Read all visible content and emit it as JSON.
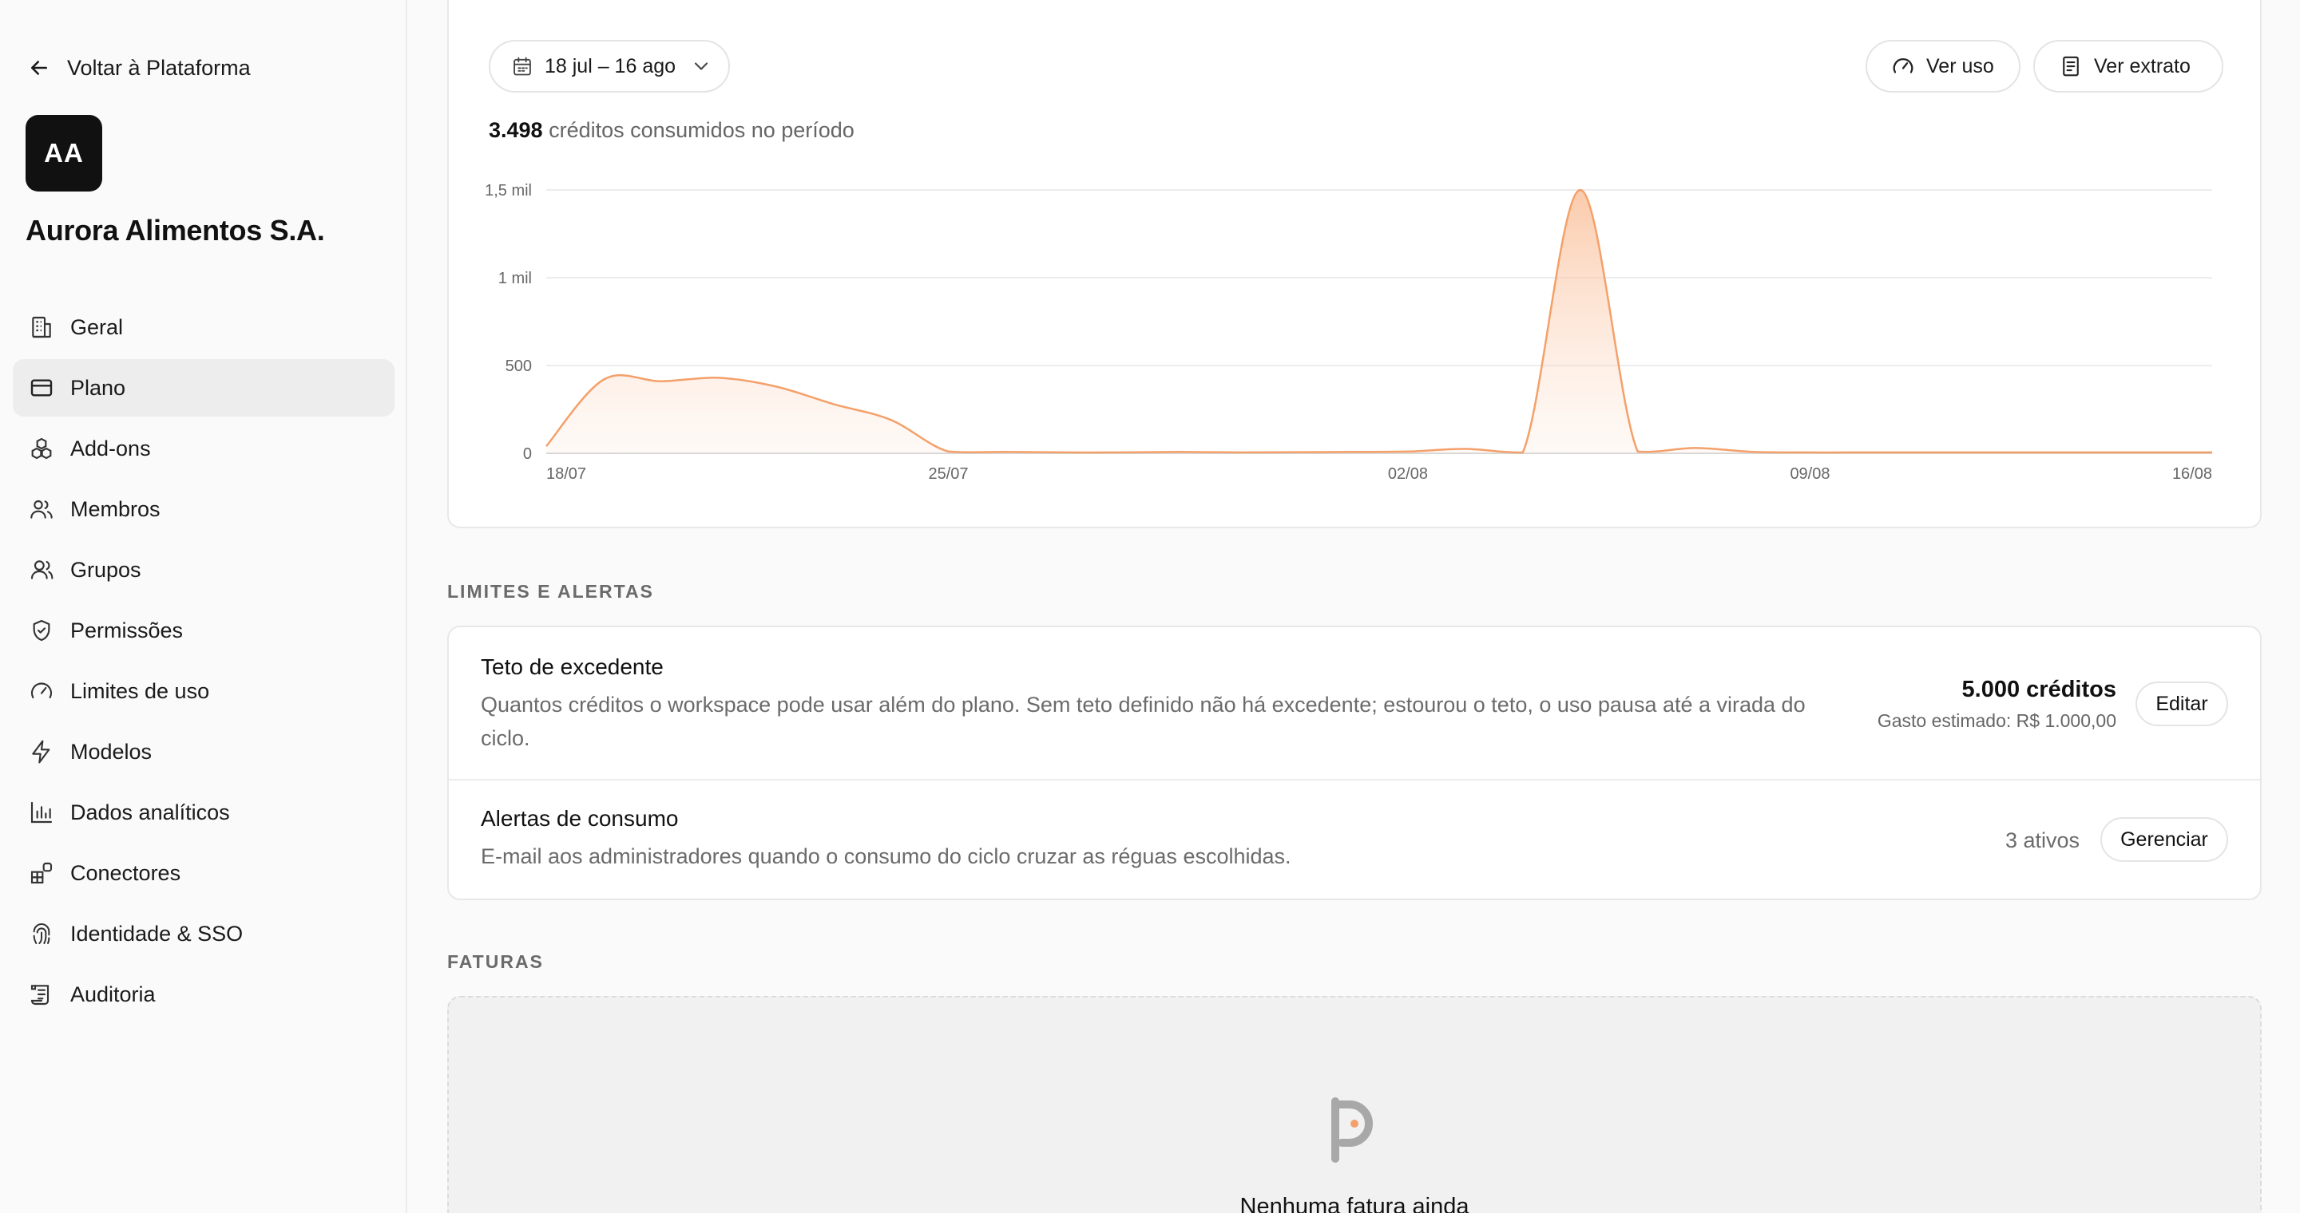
{
  "sidebar": {
    "back_label": "Voltar à Plataforma",
    "org_initials": "AA",
    "org_name": "Aurora Alimentos S.A.",
    "items": [
      {
        "label": "Geral",
        "icon": "building-icon"
      },
      {
        "label": "Plano",
        "icon": "credit-card-icon",
        "active": true
      },
      {
        "label": "Add-ons",
        "icon": "blocks-icon"
      },
      {
        "label": "Membros",
        "icon": "users-icon"
      },
      {
        "label": "Grupos",
        "icon": "group-icon"
      },
      {
        "label": "Permissões",
        "icon": "shield-check-icon"
      },
      {
        "label": "Limites de uso",
        "icon": "gauge-icon"
      },
      {
        "label": "Modelos",
        "icon": "lightning-icon"
      },
      {
        "label": "Dados analíticos",
        "icon": "bar-chart-icon"
      },
      {
        "label": "Conectores",
        "icon": "apps-plus-icon"
      },
      {
        "label": "Identidade & SSO",
        "icon": "fingerprint-icon"
      },
      {
        "label": "Auditoria",
        "icon": "scroll-icon"
      }
    ]
  },
  "usage": {
    "date_range": "18 jul – 16 ago",
    "ver_uso": "Ver uso",
    "ver_extrato": "Ver extrato",
    "credits_total": "3.498",
    "credits_suffix": "créditos consumidos no período"
  },
  "chart_data": {
    "type": "area",
    "x_labels": [
      "18/07",
      "25/07",
      "02/08",
      "09/08",
      "16/08"
    ],
    "y_ticks": [
      "0",
      "500",
      "1 mil",
      "1,5 mil"
    ],
    "ylim": [
      0,
      1500
    ],
    "grid": true,
    "x": [
      "18/07",
      "19/07",
      "20/07",
      "21/07",
      "22/07",
      "23/07",
      "24/07",
      "25/07",
      "26/07",
      "27/07",
      "28/07",
      "29/07",
      "30/07",
      "31/07",
      "01/08",
      "02/08",
      "03/08",
      "04/08",
      "05/08",
      "06/08",
      "07/08",
      "08/08",
      "09/08",
      "10/08",
      "11/08",
      "12/08",
      "13/08",
      "14/08",
      "15/08",
      "16/08"
    ],
    "values": [
      40,
      420,
      410,
      430,
      380,
      280,
      190,
      10,
      8,
      5,
      5,
      8,
      5,
      6,
      8,
      10,
      25,
      5,
      1500,
      10,
      30,
      8,
      5,
      5,
      5,
      5,
      5,
      5,
      5,
      5
    ],
    "colors": {
      "line": "#f4a06a",
      "fill": "#fbd3b6"
    }
  },
  "limits": {
    "section_title": "LIMITES E ALERTAS",
    "overage_title": "Teto de excedente",
    "overage_desc": "Quantos créditos o workspace pode usar além do plano. Sem teto definido não há excedente; estourou o teto, o uso pausa até a virada do ciclo.",
    "overage_value": "5.000 créditos",
    "overage_estimate": "Gasto estimado: R$ 1.000,00",
    "edit_label": "Editar",
    "alerts_title": "Alertas de consumo",
    "alerts_desc": "E-mail aos administradores quando o consumo do ciclo cruzar as réguas escolhidas.",
    "alerts_count": "3 ativos",
    "manage_label": "Gerenciar"
  },
  "invoices": {
    "section_title": "FATURAS",
    "empty_text": "Nenhuma fatura ainda"
  }
}
